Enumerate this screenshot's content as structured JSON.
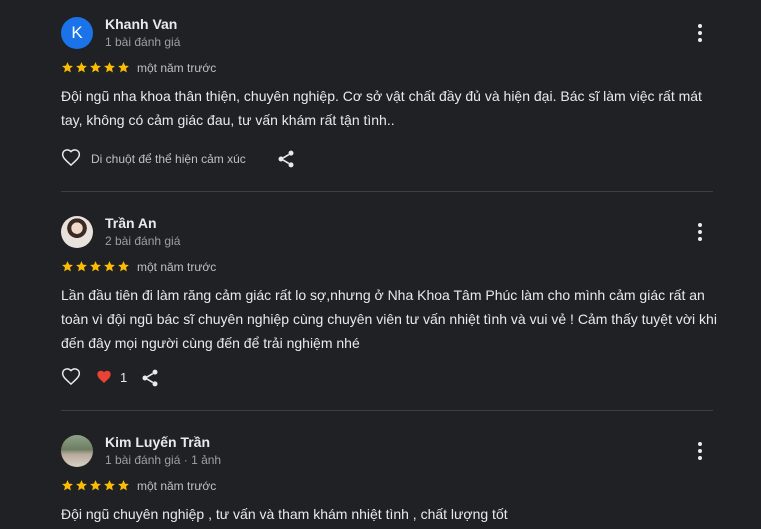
{
  "reviews": [
    {
      "avatar_letter": "K",
      "name": "Khanh Van",
      "meta": "1 bài đánh giá",
      "rating": 5,
      "time": "một năm trước",
      "text": "Đội ngũ nha khoa thân thiện, chuyên nghiệp. Cơ sở vật chất đầy đủ và hiện đại. Bác sĩ làm việc rất mát tay, không có cảm giác đau, tư vấn khám rất tận tình..",
      "hover_label": "Di chuột để thể hiện cảm xúc"
    },
    {
      "name": "Trần An",
      "meta": "2 bài đánh giá",
      "rating": 5,
      "time": "một năm trước",
      "text": "Lần đầu tiên đi làm răng cảm giác rất lo sợ,nhưng ở Nha Khoa Tâm Phúc làm cho mình cảm giác rất an toàn vì đội ngũ bác sĩ chuyên nghiệp cùng chuyên viên tư vấn nhiệt tình và vui vẻ ! Cảm thấy tuyệt vời khi đến đây mọi người cùng đến để trải nghiệm nhé",
      "like_count": "1"
    },
    {
      "name": "Kim Luyến Trần",
      "meta": "1 bài đánh giá · 1 ảnh",
      "rating": 5,
      "time": "một năm trước",
      "text": "Đội ngũ chuyên nghiệp , tư vấn và tham khám nhiệt tình , chất lượng tốt"
    }
  ],
  "colors": {
    "background": "#202124",
    "star": "#fbbc04",
    "heart_filled": "#ea4335",
    "avatar_k": "#1a73e8"
  },
  "icons": [
    "more-vert-icon",
    "star-icon",
    "heart-outline-icon",
    "heart-filled-icon",
    "share-icon"
  ]
}
